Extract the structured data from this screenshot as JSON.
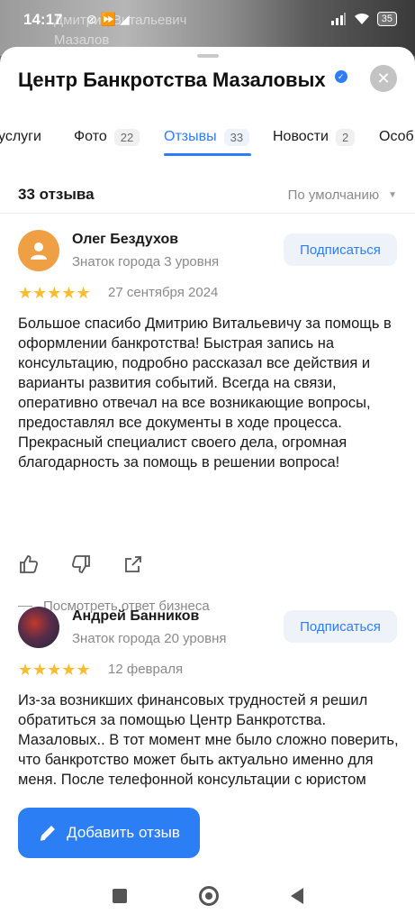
{
  "status": {
    "time": "14:17",
    "extra": "⊘ ⏩ ◢",
    "battery": "35",
    "bg_text_line1": "Дмитрий Витальевич",
    "bg_text_line2": "Мазалов"
  },
  "header": {
    "title": "Центр Банкротства Мазаловых",
    "close_label": "✕"
  },
  "tabs": [
    {
      "label": "услуги",
      "count": ""
    },
    {
      "label": "Фото",
      "count": "22"
    },
    {
      "label": "Отзывы",
      "count": "33"
    },
    {
      "label": "Новости",
      "count": "2"
    },
    {
      "label": "Особ",
      "count": ""
    }
  ],
  "summary": {
    "total": "33 отзыва",
    "sort": "По умолчанию"
  },
  "reviews": [
    {
      "name": "Олег Бездухов",
      "level": "Знаток города 3 уровня",
      "subscribe": "Подписаться",
      "stars": "★★★★★",
      "rating": 5,
      "date": "27 сентября 2024",
      "text": "Большое спасибо Дмитрию Витальевичу за помощь в оформлении банкротства! Быстрая запись на консультацию, подробно рассказал все действия и варианты развития событий. Всегда на связи, оперативно отвечал на все возникающие вопросы, предоставлял все документы в ходе процесса. Прекрасный специалист своего дела, огромная благодарность за помощь в решении вопроса!",
      "answer": "Посмотреть ответ бизнеса"
    },
    {
      "name": "Андрей Банников",
      "level": "Знаток города 20 уровня",
      "subscribe": "Подписаться",
      "stars": "★★★★★",
      "rating": 5,
      "date": "12 февраля",
      "text": "Из-за возникших финансовых трудностей я решил обратиться за помощью Центр Банкротства. Мазаловых.. В тот момент мне было сложно поверить, что банкротство может быть актуально именно для меня. После телефонной консультации с юристом"
    }
  ],
  "add_review": "Добавить отзыв",
  "colors": {
    "accent": "#2f7df6",
    "star": "#fbbd2b",
    "button": "#2c7ef5"
  }
}
